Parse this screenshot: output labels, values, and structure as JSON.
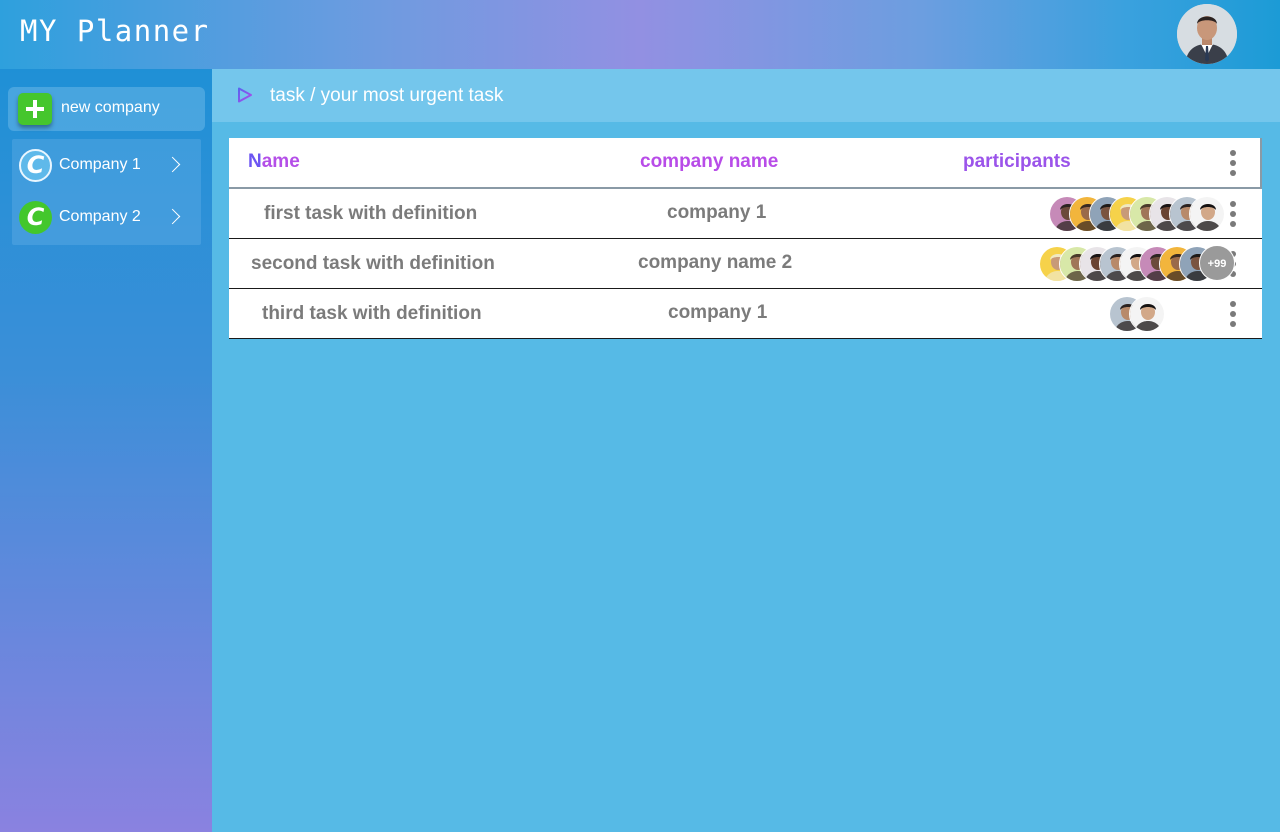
{
  "header": {
    "app_title": "MY Planner",
    "user_avatar": "user-avatar"
  },
  "sidebar": {
    "new_company_label": "new company",
    "companies": [
      {
        "label": "Company 1",
        "logo_letter": "C",
        "logo_color": "#5fb9ea"
      },
      {
        "label": "Company 2",
        "logo_letter": "C",
        "logo_color": "#43c72c"
      }
    ]
  },
  "breadcrumb": {
    "text": "task / your most urgent task"
  },
  "table": {
    "headers": {
      "name_first": "N",
      "name_rest": "ame",
      "company": "company name",
      "participants": "participants"
    },
    "rows": [
      {
        "task": "first task with definition",
        "company": "company 1",
        "participant_count": 8,
        "more_badge": ""
      },
      {
        "task": "second task with definition",
        "company": "company name 2",
        "participant_count": 8,
        "more_badge": "+99"
      },
      {
        "task": "third task with definition",
        "company": "company 1",
        "participant_count": 2,
        "more_badge": ""
      }
    ]
  },
  "colors": {
    "accent_purple": "#b44fe8",
    "accent_blue": "#6c55f2",
    "add_green": "#45c62d",
    "background": "#56bae6"
  }
}
